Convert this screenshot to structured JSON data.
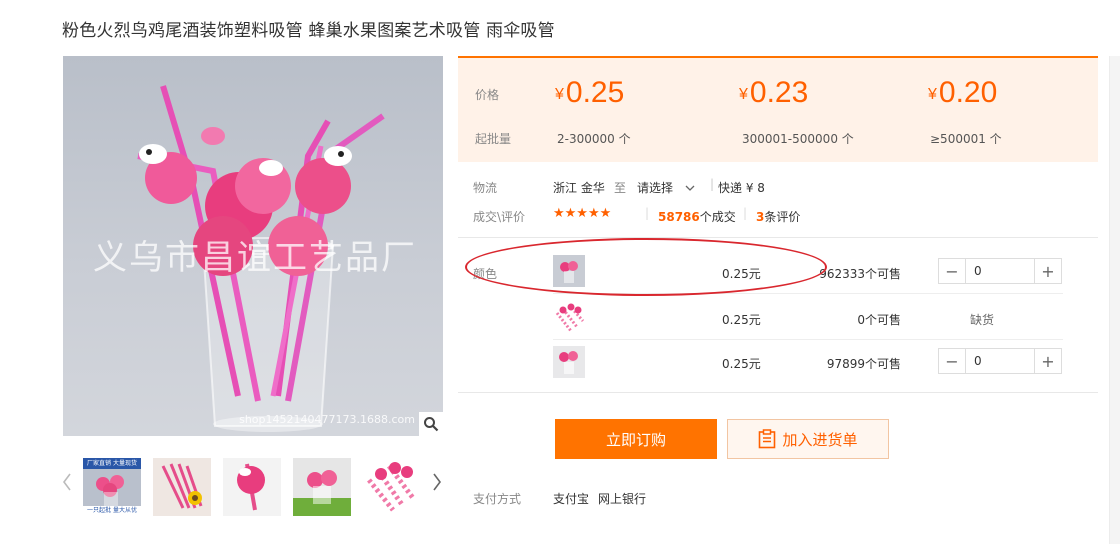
{
  "product": {
    "title": "粉色火烈鸟鸡尾酒装饰塑料吸管 蜂巢水果图案艺术吸管 雨伞吸管",
    "watermark": "义乌市昌谊工艺品厂",
    "shop_mark": "shop1452140477173.1688.com"
  },
  "thumbnails": {
    "prev_icon": "chevron-left-icon",
    "next_icon": "chevron-right-icon",
    "count": 5,
    "first_caption_top": "厂家直销 大量现货",
    "first_caption_bottom": "一只起批 量大从优"
  },
  "pricing": {
    "price_label": "价格",
    "moq_label": "起批量",
    "currency": "¥",
    "tiers": [
      {
        "price": "0.25",
        "range": "2-300000 个"
      },
      {
        "price": "0.23",
        "range": "300001-500000 个"
      },
      {
        "price": "0.20",
        "range": "≥500001 个"
      }
    ]
  },
  "logistics": {
    "label": "物流",
    "origin": "浙江 金华",
    "to": "至",
    "destination": "请选择",
    "express": "快递 ¥ 8"
  },
  "reviews": {
    "label": "成交\\评价",
    "stars": "★★★★★",
    "deals_count": "58786",
    "deals_suffix": "个成交",
    "review_count": "3",
    "review_suffix": "条评价"
  },
  "sku": {
    "label": "颜色",
    "rows": [
      {
        "price": "0.25元",
        "stock": "962333个可售",
        "qty": "0",
        "status": ""
      },
      {
        "price": "0.25元",
        "stock": "0个可售",
        "qty": "",
        "status": "缺货"
      },
      {
        "price": "0.25元",
        "stock": "97899个可售",
        "qty": "0",
        "status": ""
      }
    ]
  },
  "actions": {
    "order_label": "立即订购",
    "cart_label": "加入进货单"
  },
  "payment": {
    "label": "支付方式",
    "methods": [
      "支付宝",
      "网上银行"
    ]
  },
  "colors": {
    "accent": "#ff7300",
    "price": "#ff6000",
    "highlight": "#d9272e"
  }
}
